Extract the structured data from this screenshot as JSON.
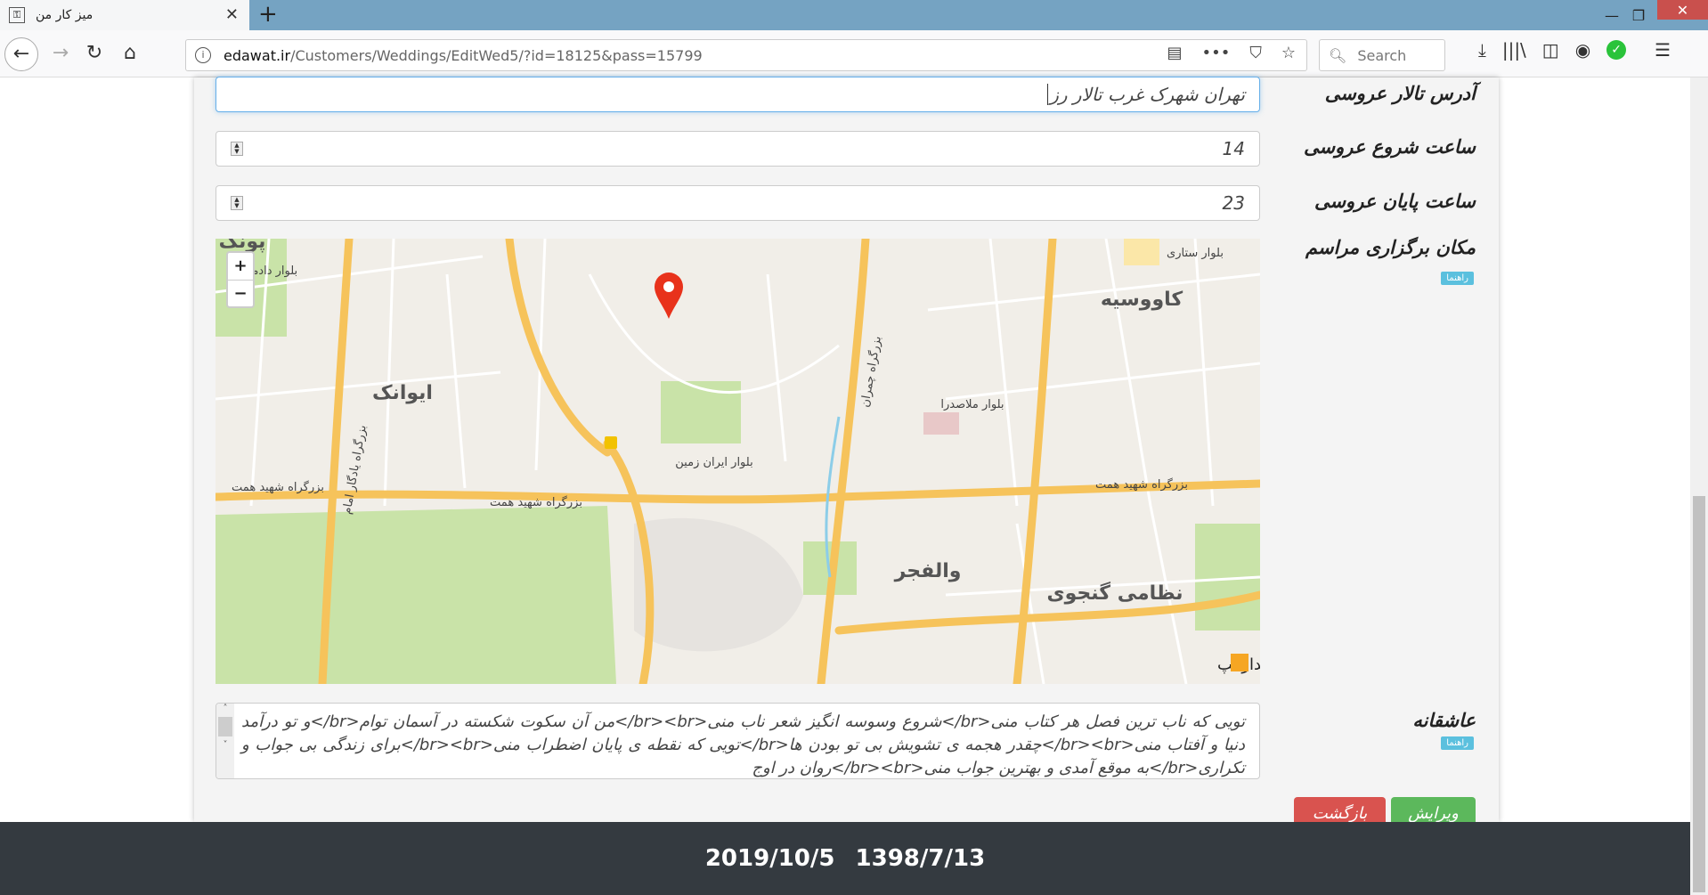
{
  "browser": {
    "tab_title": "میز کار من",
    "url_host": "edawat.ir",
    "url_path": "/Customers/Weddings/EditWed5/?id=18125&pass=15799",
    "search_placeholder": "Search"
  },
  "form": {
    "address_label": "آدرس تالار عروسی",
    "address_value": "تهران شهرک غرب تالار رز",
    "start_label": "ساعت شروع عروسی",
    "start_value": "14",
    "end_label": "ساعت پایان عروسی",
    "end_value": "23",
    "location_label": "مکان برگزاری مراسم",
    "help_label": "راهنما",
    "love_label": "عاشقانه",
    "love_text": "تویی که ناب ترین فصل هر کتاب منی<br/>شروع وسوسه انگیز شعر ناب منی<br><br/>من آن سکوت شکسته در آسمان توام<br/>و تو درآمد دنیا و آفتاب منی<br><br/>چقدر هجمه ی تشویش بی تو بودن ها<br/>تویی که نقطه ی پایان اضطراب منی<br><br/>برای زندگی بی جواب و تکراری<br/>به موقع آمدی و بهترین جواب منی<br><br/>روان در اوج",
    "edit_button": "ویرایش",
    "back_button": "بازگشت"
  },
  "map": {
    "zoom_in": "+",
    "zoom_out": "−",
    "labels": {
      "evanak": "ایوانک",
      "kavousieh": "کاووسیه",
      "valfajr": "والفجر",
      "nezami": "نظامی گنجوی",
      "hemmat1": "بزرگراه شهید همت",
      "hemmat2": "بزرگراه شهید همت",
      "hemmat3": "بزرگراه شهید همت",
      "chamran": "بزرگراه چمران",
      "yadegar": "بزرگراه یادگار امام",
      "mollasadra": "بلوار ملاصدرا",
      "dadman": "بلوار دادمان",
      "setari": "بلوار ستاری",
      "iranzamin": "بلوار ایران زمین",
      "poonak": "پونک"
    },
    "provider": "سیدارمپ",
    "colors": {
      "land": "#f1eee8",
      "park": "#c9e3a8",
      "highway": "#f6c35b",
      "road": "#ffffff",
      "marker": "#e8321b"
    }
  },
  "footer": {
    "gregorian": "2019/10/5",
    "jalali": "1398/7/13"
  }
}
